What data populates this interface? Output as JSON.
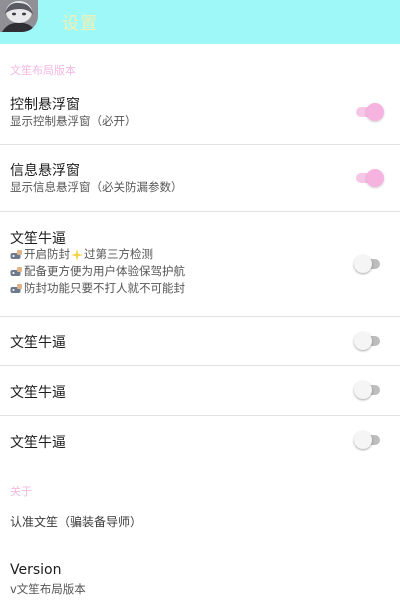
{
  "appbar": {
    "title": "设置"
  },
  "sections": [
    {
      "header": "文笙布局版本"
    },
    {
      "header": "关于"
    }
  ],
  "settings": [
    {
      "title": "控制悬浮窗",
      "subtitle": "显示控制悬浮窗（必开）",
      "toggle_on": true
    },
    {
      "title": "信息悬浮窗",
      "subtitle": "显示信息悬浮窗（必关防漏参数）",
      "toggle_on": true
    },
    {
      "title": "文笙牛逼",
      "sub_lines": [
        {
          "text_a": "开启防封",
          "text_b": "过第三方检测"
        },
        {
          "text_a": "配备更方便为用户体验保驾护航"
        },
        {
          "text_a": "防封功能只要不打人就不可能封"
        }
      ],
      "toggle_on": false
    },
    {
      "title": "文笙牛逼",
      "toggle_on": false
    },
    {
      "title": "文笙牛逼",
      "toggle_on": false
    },
    {
      "title": "文笙牛逼",
      "toggle_on": false
    }
  ],
  "about": {
    "note": "认准文笙（骗装备导师）",
    "version_title": "Version",
    "version_value": "v文笙布局版本"
  },
  "icons": {
    "line_icon": "gamepad-hand-icon",
    "inline_icon": "sparkle-icon"
  },
  "colors": {
    "appbar_bg": "#9ff8f8",
    "title_text": "#f2f0b4",
    "section_header": "#f3b9e3",
    "switch_on_thumb": "#f6b3e0",
    "switch_on_track": "#f6c6e6",
    "switch_off_track": "#bdbdbd"
  }
}
